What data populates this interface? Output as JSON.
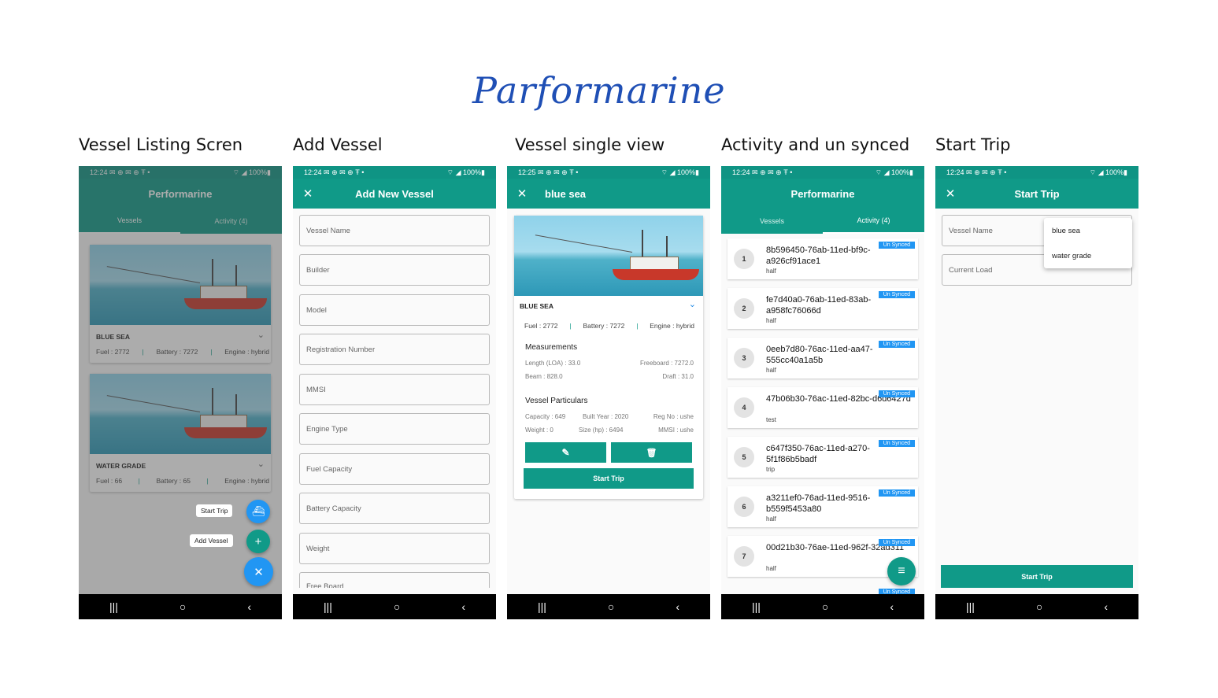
{
  "brand": "Parformarine",
  "captions": [
    "Vessel Listing Scren",
    "Add Vessel",
    "Vessel single view",
    "Activity and un synced",
    "Start Trip"
  ],
  "status": {
    "time": "12:24",
    "time_alt": "12:25",
    "icons": "✉ ⊕ ✉ ⊕ Ŧ •",
    "right": "⌔ ◢ 100%▮"
  },
  "nav": {
    "recents": "|||",
    "home": "○",
    "back": "‹"
  },
  "listing": {
    "title": "Performarine",
    "tabs": [
      "Vessels",
      "Activity (4)"
    ],
    "vessels": [
      {
        "name": "BLUE SEA",
        "fuel": "Fuel : 2772",
        "battery": "Battery : 7272",
        "engine": "Engine : hybrid"
      },
      {
        "name": "WATER GRADE",
        "fuel": "Fuel : 66",
        "battery": "Battery : 65",
        "engine": "Engine : hybrid"
      }
    ],
    "fab_start_label": "Start Trip",
    "fab_add_label": "Add Vessel",
    "chevron": "⌄",
    "icon_ship": "⛴",
    "icon_plus": "+",
    "icon_close": "✕"
  },
  "add_vessel": {
    "close": "✕",
    "title": "Add New Vessel",
    "fields": [
      "Vessel Name",
      "Builder",
      "Model",
      "Registration Number",
      "MMSI",
      "Engine Type",
      "Fuel Capacity",
      "Battery Capacity",
      "Weight",
      "Free Board"
    ]
  },
  "single": {
    "close": "✕",
    "title": "blue sea",
    "name": "BLUE SEA",
    "chevron": "⌄",
    "fuel": "Fuel : 2772",
    "battery": "Battery : 7272",
    "engine": "Engine : hybrid",
    "measurements_title": "Measurements",
    "length": "Length (LOA) : 33.0",
    "freeboard": "Freeboard : 7272.0",
    "beam": "Beam : 828.0",
    "draft": "Draft : 31.0",
    "particulars_title": "Vessel Particulars",
    "capacity": "Capacity : 649",
    "built_year": "Built Year : 2020",
    "reg_no": "Reg No : ushe",
    "weight": "Weight : 0",
    "size": "Size (hp) : 6494",
    "mmsi": "MMSI : ushe",
    "edit_icon": "✎",
    "delete_icon": "🗑",
    "start_trip": "Start Trip"
  },
  "activity": {
    "title": "Performarine",
    "tabs": [
      "Vessels",
      "Activity (4)"
    ],
    "badge": "Un Synced",
    "fab_icon": "≡",
    "items": [
      {
        "num": "1",
        "id": "8b596450-76ab-11ed-bf9c-a926cf91ace1",
        "sub": "half"
      },
      {
        "num": "2",
        "id": "fe7d40a0-76ab-11ed-83ab-a958fc76066d",
        "sub": "half"
      },
      {
        "num": "3",
        "id": "0eeb7d80-76ac-11ed-aa47-555cc40a1a5b",
        "sub": "half"
      },
      {
        "num": "4",
        "id": "47b06b30-76ac-11ed-82bc-d6d6427d",
        "sub": "test"
      },
      {
        "num": "5",
        "id": "c647f350-76ac-11ed-a270-5f1f86b5badf",
        "sub": "trip"
      },
      {
        "num": "6",
        "id": "a3211ef0-76ad-11ed-9516-b559f5453a80",
        "sub": "half"
      },
      {
        "num": "7",
        "id": "00d21b30-76ae-11ed-962f-32ad311",
        "sub": "half"
      }
    ]
  },
  "start_trip": {
    "close": "✕",
    "title": "Start Trip",
    "vessel_field": "Vessel Name",
    "load_field": "Current Load",
    "options": [
      "blue sea",
      "water grade"
    ],
    "button": "Start Trip"
  }
}
